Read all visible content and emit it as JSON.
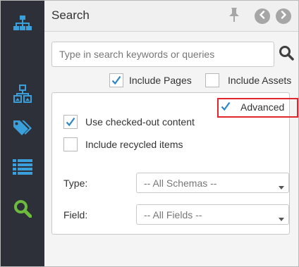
{
  "rail": {
    "items": [
      {
        "icon": "sitemap-icon",
        "active": true
      },
      {
        "icon": "hierarchy-image-icon",
        "active": false
      },
      {
        "icon": "tags-icon",
        "active": false
      },
      {
        "icon": "list-icon",
        "active": false
      },
      {
        "icon": "search-icon",
        "active": true
      }
    ],
    "colors": {
      "background": "#2d3038",
      "icon": "#3aa0dc",
      "search_icon": "#6dbb3c"
    }
  },
  "header": {
    "title": "Search",
    "buttons": [
      {
        "icon": "pin-icon"
      },
      {
        "icon": "chevron-left-icon"
      },
      {
        "icon": "chevron-right-icon"
      }
    ]
  },
  "search": {
    "value": "",
    "placeholder": "Type in search keywords or queries",
    "button_icon": "search-icon"
  },
  "options": {
    "include_pages": {
      "label": "Include Pages",
      "checked": true
    },
    "include_assets": {
      "label": "Include Assets",
      "checked": false
    }
  },
  "advanced": {
    "toggle": {
      "label": "Advanced",
      "checked": true,
      "highlight_color": "#e0262f"
    },
    "use_checked_out": {
      "label": "Use checked-out content",
      "checked": true
    },
    "include_recycled": {
      "label": "Include recycled items",
      "checked": false
    },
    "type": {
      "label": "Type:",
      "selected": "-- All Schemas --"
    },
    "field": {
      "label": "Field:",
      "selected": "-- All Fields --"
    }
  },
  "colors": {
    "checkmark": "#2e86c8",
    "panel": "#f4f4f4"
  }
}
